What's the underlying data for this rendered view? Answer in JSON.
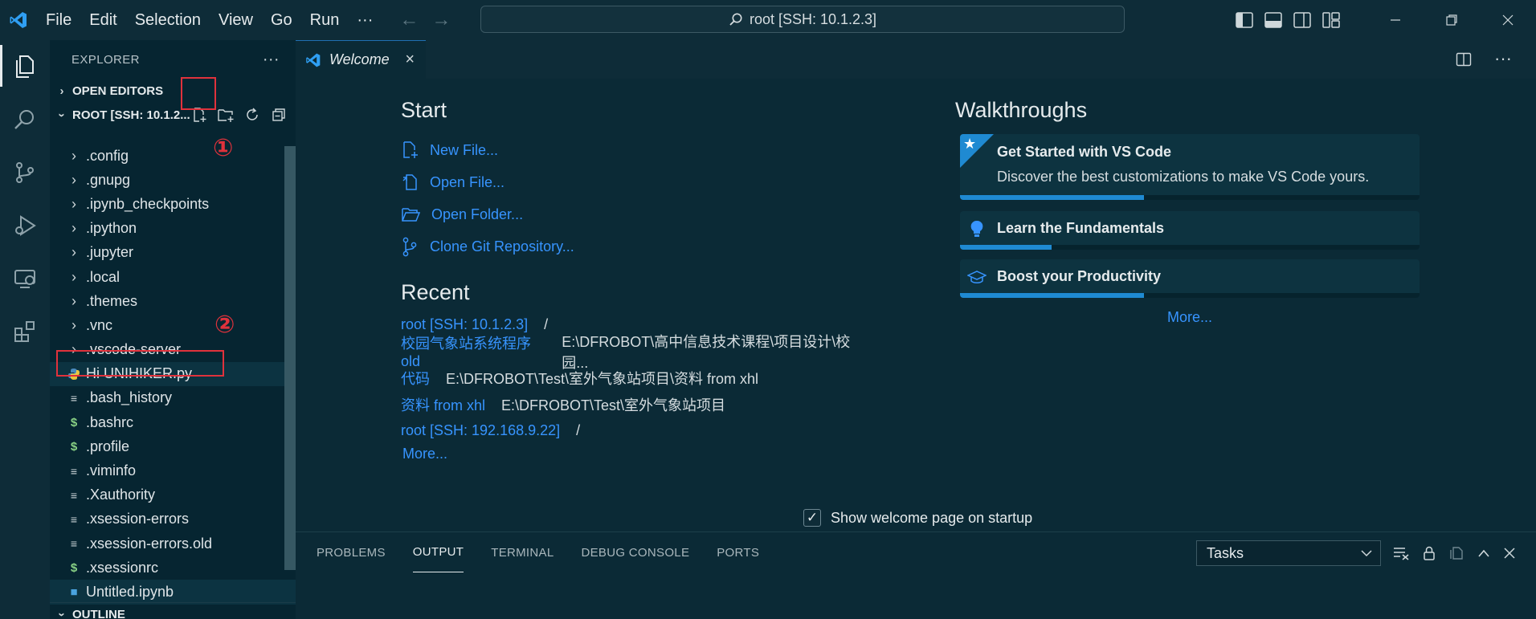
{
  "titlebar": {
    "menu": [
      "File",
      "Edit",
      "Selection",
      "View",
      "Go",
      "Run",
      "···"
    ],
    "command_center": "root [SSH: 10.1.2.3]"
  },
  "explorer": {
    "header": "EXPLORER",
    "open_editors": "OPEN EDITORS",
    "root_label": "ROOT [SSH: 10.1.2...",
    "marker1": "①",
    "marker2": "②",
    "tree": [
      {
        "label": ".config",
        "kind": "folder"
      },
      {
        "label": ".gnupg",
        "kind": "folder"
      },
      {
        "label": ".ipynb_checkpoints",
        "kind": "folder"
      },
      {
        "label": ".ipython",
        "kind": "folder"
      },
      {
        "label": ".jupyter",
        "kind": "folder"
      },
      {
        "label": ".local",
        "kind": "folder"
      },
      {
        "label": ".themes",
        "kind": "folder"
      },
      {
        "label": ".vnc",
        "kind": "folder"
      },
      {
        "label": ".vscode-server",
        "kind": "folder"
      },
      {
        "label": "Hi UNIHIKER.py",
        "kind": "python"
      },
      {
        "label": ".bash_history",
        "kind": "text"
      },
      {
        "label": ".bashrc",
        "kind": "shell"
      },
      {
        "label": ".profile",
        "kind": "shell"
      },
      {
        "label": ".viminfo",
        "kind": "text"
      },
      {
        "label": ".Xauthority",
        "kind": "text"
      },
      {
        "label": ".xsession-errors",
        "kind": "text"
      },
      {
        "label": ".xsession-errors.old",
        "kind": "text"
      },
      {
        "label": ".xsessionrc",
        "kind": "shell"
      },
      {
        "label": "Untitled.ipynb",
        "kind": "notebook"
      }
    ],
    "outline": "OUTLINE"
  },
  "editor": {
    "tab_label": "Welcome",
    "start": {
      "heading": "Start",
      "items": [
        "New File...",
        "Open File...",
        "Open Folder...",
        "Clone Git Repository..."
      ]
    },
    "recent": {
      "heading": "Recent",
      "items": [
        {
          "name": "root [SSH: 10.1.2.3]",
          "path": "/"
        },
        {
          "name": "校园气象站系统程序old",
          "path": "E:\\DFROBOT\\高中信息技术课程\\项目设计\\校园..."
        },
        {
          "name": "代码",
          "path": "E:\\DFROBOT\\Test\\室外气象站项目\\资料 from xhl"
        },
        {
          "name": "资料 from xhl",
          "path": "E:\\DFROBOT\\Test\\室外气象站项目"
        },
        {
          "name": "root [SSH: 192.168.9.22]",
          "path": "/"
        }
      ],
      "more": "More..."
    },
    "walkthroughs": {
      "heading": "Walkthroughs",
      "cards": [
        {
          "title": "Get Started with VS Code",
          "desc": "Discover the best customizations to make VS Code yours.",
          "progress": 0.4
        },
        {
          "title": "Learn the Fundamentals",
          "progress": 0.2
        },
        {
          "title": "Boost your Productivity",
          "progress": 0.4
        }
      ],
      "more": "More..."
    },
    "show_on_startup": "Show welcome page on startup"
  },
  "panel": {
    "tabs": [
      "PROBLEMS",
      "OUTPUT",
      "TERMINAL",
      "DEBUG CONSOLE",
      "PORTS"
    ],
    "active_tab": "OUTPUT",
    "select_value": "Tasks"
  },
  "colors": {
    "accent": "#3794ff",
    "annotation_red": "#e0323c",
    "progress": "#1f8ad2"
  }
}
